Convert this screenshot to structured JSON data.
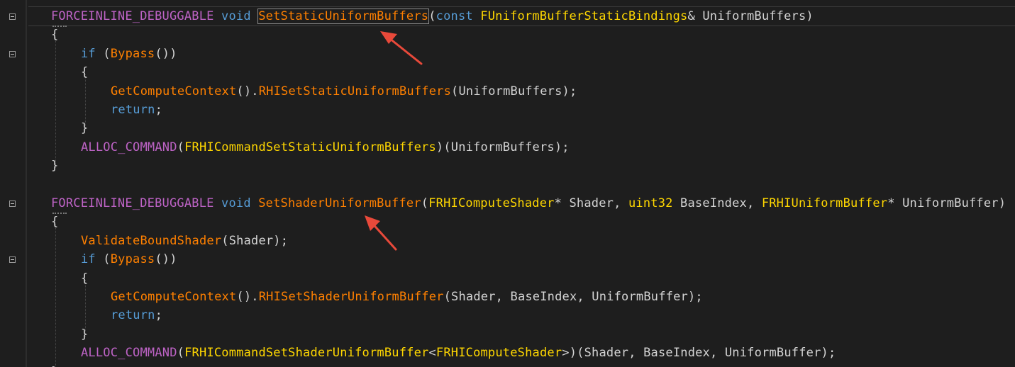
{
  "editor": {
    "theme_colors": {
      "background": "#1e1e1e",
      "macro": "#bd63c5",
      "keyword": "#569cd6",
      "function": "#ff8000",
      "type": "#ffd700",
      "plain": "#d4d4d4",
      "annotation_arrow": "#e8493a"
    },
    "code_lines": [
      {
        "indent": 1,
        "tokens": [
          {
            "t": "FORCEINLINE_DEBUGGABLE",
            "c": "macro"
          },
          {
            "t": " ",
            "c": "pl"
          },
          {
            "t": "void",
            "c": "kw"
          },
          {
            "t": " ",
            "c": "pl"
          },
          {
            "t": "SetStaticUniformBuffers",
            "c": "fn",
            "hl": true
          },
          {
            "t": "(",
            "c": "pl"
          },
          {
            "t": "const",
            "c": "kw"
          },
          {
            "t": " ",
            "c": "pl"
          },
          {
            "t": "FUniformBufferStaticBindings",
            "c": "ty"
          },
          {
            "t": "& UniformBuffers)",
            "c": "pl"
          }
        ]
      },
      {
        "indent": 1,
        "tokens": [
          {
            "t": "{",
            "c": "pl"
          }
        ]
      },
      {
        "indent": 2,
        "tokens": [
          {
            "t": "if",
            "c": "kw"
          },
          {
            "t": " (",
            "c": "pl"
          },
          {
            "t": "Bypass",
            "c": "fn"
          },
          {
            "t": "())",
            "c": "pl"
          }
        ]
      },
      {
        "indent": 2,
        "tokens": [
          {
            "t": "{",
            "c": "pl"
          }
        ]
      },
      {
        "indent": 3,
        "tokens": [
          {
            "t": "GetComputeContext",
            "c": "fn"
          },
          {
            "t": "().",
            "c": "pl"
          },
          {
            "t": "RHISetStaticUniformBuffers",
            "c": "fn"
          },
          {
            "t": "(UniformBuffers);",
            "c": "pl"
          }
        ]
      },
      {
        "indent": 3,
        "tokens": [
          {
            "t": "return",
            "c": "kw"
          },
          {
            "t": ";",
            "c": "pl"
          }
        ]
      },
      {
        "indent": 2,
        "tokens": [
          {
            "t": "}",
            "c": "pl"
          }
        ]
      },
      {
        "indent": 2,
        "tokens": [
          {
            "t": "ALLOC_COMMAND",
            "c": "macro"
          },
          {
            "t": "(",
            "c": "pl"
          },
          {
            "t": "FRHICommandSetStaticUniformBuffers",
            "c": "ty"
          },
          {
            "t": ")(UniformBuffers);",
            "c": "pl"
          }
        ]
      },
      {
        "indent": 1,
        "tokens": [
          {
            "t": "}",
            "c": "pl"
          }
        ]
      },
      {
        "indent": 0,
        "tokens": []
      },
      {
        "indent": 1,
        "tokens": [
          {
            "t": "FORCEINLINE_DEBUGGABLE",
            "c": "macro"
          },
          {
            "t": " ",
            "c": "pl"
          },
          {
            "t": "void",
            "c": "kw"
          },
          {
            "t": " ",
            "c": "pl"
          },
          {
            "t": "SetShaderUniformBuffer",
            "c": "fn"
          },
          {
            "t": "(",
            "c": "pl"
          },
          {
            "t": "FRHIComputeShader",
            "c": "ty"
          },
          {
            "t": "* Shader, ",
            "c": "pl"
          },
          {
            "t": "uint32",
            "c": "ty"
          },
          {
            "t": " BaseIndex, ",
            "c": "pl"
          },
          {
            "t": "FRHIUniformBuffer",
            "c": "ty"
          },
          {
            "t": "* UniformBuffer)",
            "c": "pl"
          }
        ]
      },
      {
        "indent": 1,
        "tokens": [
          {
            "t": "{",
            "c": "pl"
          }
        ]
      },
      {
        "indent": 2,
        "tokens": [
          {
            "t": "ValidateBoundShader",
            "c": "fn"
          },
          {
            "t": "(Shader);",
            "c": "pl"
          }
        ]
      },
      {
        "indent": 2,
        "tokens": [
          {
            "t": "if",
            "c": "kw"
          },
          {
            "t": " (",
            "c": "pl"
          },
          {
            "t": "Bypass",
            "c": "fn"
          },
          {
            "t": "())",
            "c": "pl"
          }
        ]
      },
      {
        "indent": 2,
        "tokens": [
          {
            "t": "{",
            "c": "pl"
          }
        ]
      },
      {
        "indent": 3,
        "tokens": [
          {
            "t": "GetComputeContext",
            "c": "fn"
          },
          {
            "t": "().",
            "c": "pl"
          },
          {
            "t": "RHISetShaderUniformBuffer",
            "c": "fn"
          },
          {
            "t": "(Shader, BaseIndex, UniformBuffer);",
            "c": "pl"
          }
        ]
      },
      {
        "indent": 3,
        "tokens": [
          {
            "t": "return",
            "c": "kw"
          },
          {
            "t": ";",
            "c": "pl"
          }
        ]
      },
      {
        "indent": 2,
        "tokens": [
          {
            "t": "}",
            "c": "pl"
          }
        ]
      },
      {
        "indent": 2,
        "tokens": [
          {
            "t": "ALLOC_COMMAND",
            "c": "macro"
          },
          {
            "t": "(",
            "c": "pl"
          },
          {
            "t": "FRHICommandSetShaderUniformBuffer",
            "c": "ty"
          },
          {
            "t": "<",
            "c": "pl"
          },
          {
            "t": "FRHIComputeShader",
            "c": "ty"
          },
          {
            "t": ">)(Shader, BaseIndex, UniformBuffer);",
            "c": "pl"
          }
        ]
      },
      {
        "indent": 1,
        "tokens": [
          {
            "t": "}",
            "c": "pl"
          }
        ]
      }
    ],
    "fold_rows": [
      0,
      2,
      10,
      13
    ],
    "dotted_rows": [
      0,
      10
    ]
  }
}
